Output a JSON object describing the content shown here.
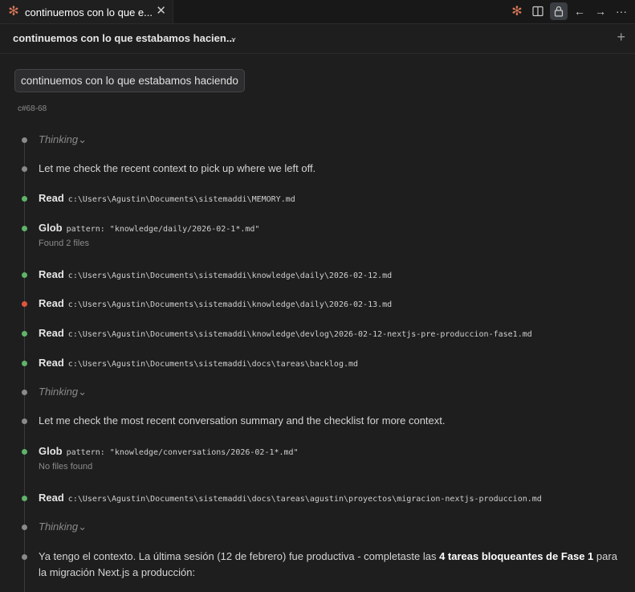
{
  "tab": {
    "title": "continuemos con lo que e...",
    "close": "✕"
  },
  "header": {
    "title": "continuemos con lo que estabamos hacien...",
    "chevron": "⌄",
    "plus": "+"
  },
  "user_message": "continuemos con lo que estabamos haciendo",
  "ref": "c#68-68",
  "entries": [
    {
      "kind": "thinking",
      "label": "Thinking"
    },
    {
      "kind": "text",
      "text": "Let me check the recent context to pick up where we left off."
    },
    {
      "kind": "tool",
      "status": "success",
      "tool": "Read",
      "arg": "c:\\Users\\Agustin\\Documents\\sistemaddi\\MEMORY.md"
    },
    {
      "kind": "tool",
      "status": "success",
      "tool": "Glob",
      "arg": "pattern: \"knowledge/daily/2026-02-1*.md\"",
      "result": "Found 2 files"
    },
    {
      "kind": "tool",
      "status": "success",
      "tool": "Read",
      "arg": "c:\\Users\\Agustin\\Documents\\sistemaddi\\knowledge\\daily\\2026-02-12.md"
    },
    {
      "kind": "tool",
      "status": "error",
      "tool": "Read",
      "arg": "c:\\Users\\Agustin\\Documents\\sistemaddi\\knowledge\\daily\\2026-02-13.md"
    },
    {
      "kind": "tool",
      "status": "success",
      "tool": "Read",
      "arg": "c:\\Users\\Agustin\\Documents\\sistemaddi\\knowledge\\devlog\\2026-02-12-nextjs-pre-produccion-fase1.md"
    },
    {
      "kind": "tool",
      "status": "success",
      "tool": "Read",
      "arg": "c:\\Users\\Agustin\\Documents\\sistemaddi\\docs\\tareas\\backlog.md"
    },
    {
      "kind": "thinking",
      "label": "Thinking"
    },
    {
      "kind": "text",
      "text": "Let me check the most recent conversation summary and the checklist for more context."
    },
    {
      "kind": "tool",
      "status": "success",
      "tool": "Glob",
      "arg": "pattern: \"knowledge/conversations/2026-02-1*.md\"",
      "result": "No files found"
    },
    {
      "kind": "tool",
      "status": "success",
      "tool": "Read",
      "arg": "c:\\Users\\Agustin\\Documents\\sistemaddi\\docs\\tareas\\agustin\\proyectos\\migracion-nextjs-produccion.md"
    },
    {
      "kind": "thinking",
      "label": "Thinking"
    }
  ],
  "final": {
    "part1": "Ya tengo el contexto. La última sesión (12 de febrero) fue productiva - completaste las ",
    "bold": "4 tareas bloqueantes de Fase 1",
    "part2": " para la migración Next.js a producción:"
  },
  "colors": {
    "success": "#5fb36a",
    "error": "#e0533e",
    "neutral": "#8a8a8a",
    "accent": "#d97757"
  },
  "icons": [
    "claude-spark-icon",
    "split-editor-icon",
    "lock-icon",
    "arrow-left-icon",
    "arrow-right-icon",
    "more-icon"
  ]
}
